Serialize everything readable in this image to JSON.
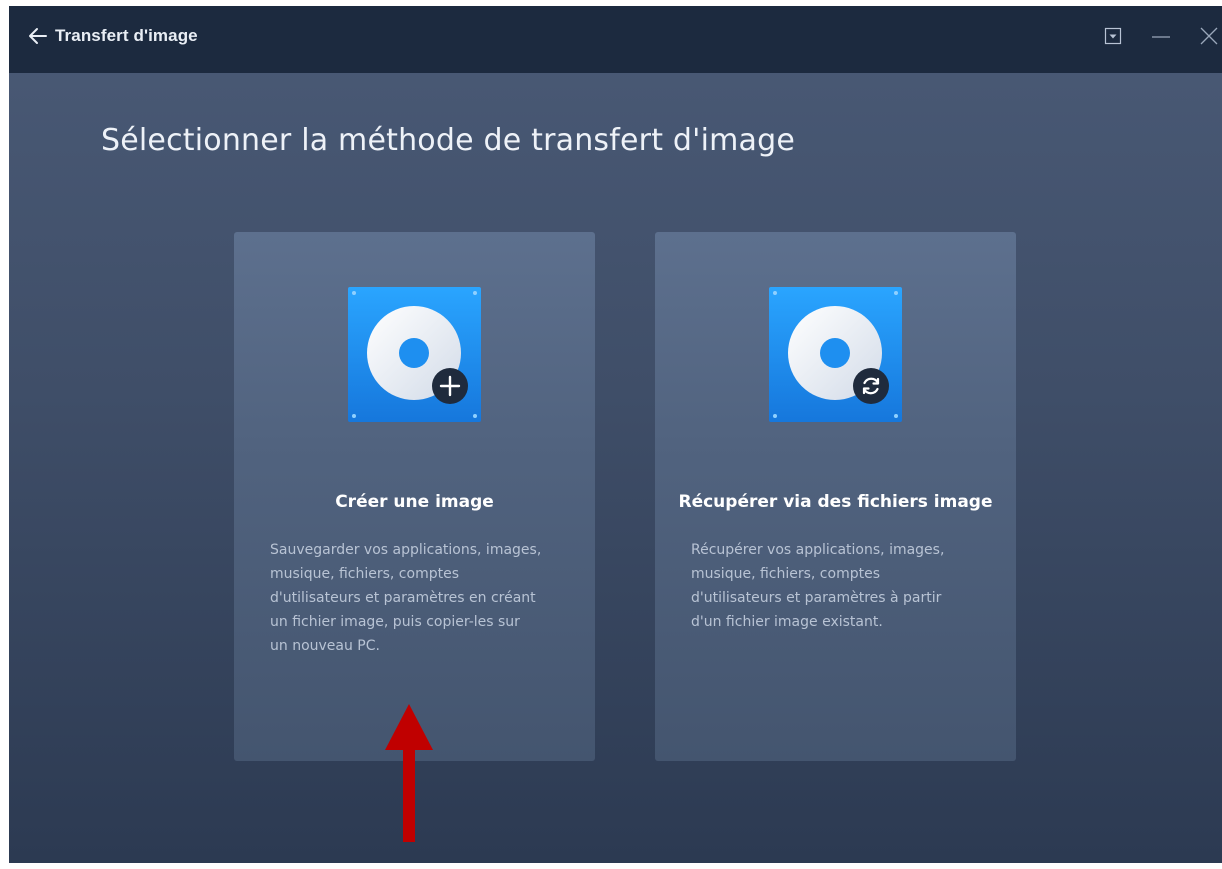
{
  "titlebar": {
    "back_label": "Transfert d'image",
    "controls": [
      "menu-dropdown",
      "minimize",
      "close"
    ]
  },
  "page_title": "Sélectionner la méthode de transfert d'image",
  "cards": [
    {
      "title": "Créer une image",
      "icon": "disk-image-add-icon",
      "description_lines": [
        "Sauvegarder vos applications, images,",
        "musique, fichiers, comptes",
        "d'utilisateurs et paramètres en créant",
        "un fichier image, puis copier-les sur",
        "un nouveau PC."
      ]
    },
    {
      "title": "Récupérer via des fichiers image",
      "icon": "disk-image-restore-icon",
      "description_lines": [
        "Récupérer vos applications, images,",
        "musique, fichiers, comptes",
        "d'utilisateurs et paramètres à partir",
        "d'un fichier image existant."
      ]
    }
  ],
  "colors": {
    "titlebar": "#1c2a3f",
    "background": "#45556f",
    "card": "#55678a",
    "icon_blue": "#1e8ff0",
    "annotation_red": "#c00000"
  },
  "annotation": {
    "icon": "red-up-arrow",
    "points_to": "Créer une image"
  }
}
